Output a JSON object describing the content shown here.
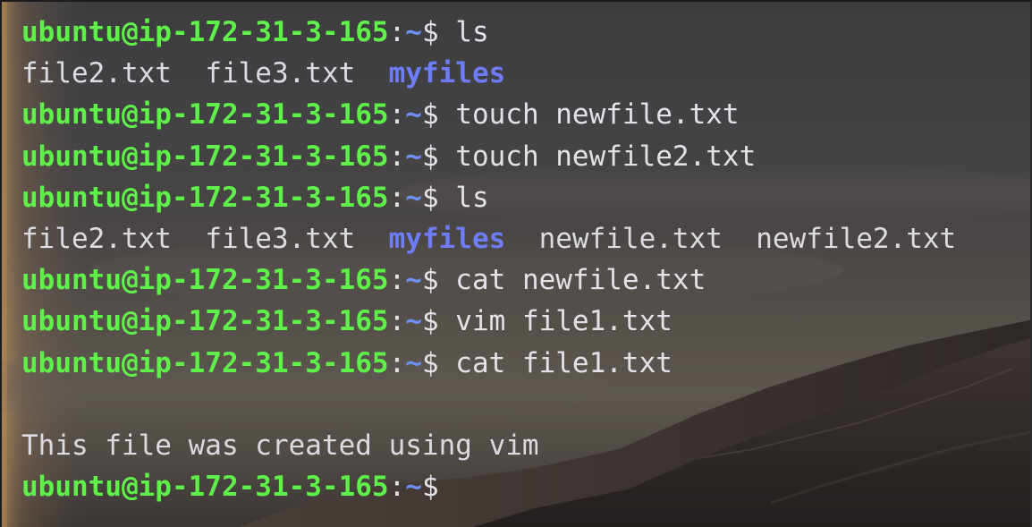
{
  "terminal": {
    "prompt": {
      "user_host": "ubuntu@ip-172-31-3-165",
      "colon": ":",
      "path": "~",
      "symbol": "$"
    },
    "lines": [
      {
        "kind": "command",
        "text": " ls"
      },
      {
        "kind": "output",
        "items": [
          {
            "text": "file2.txt",
            "type": "file"
          },
          {
            "text": "file3.txt",
            "type": "file"
          },
          {
            "text": "myfiles",
            "type": "dir"
          }
        ]
      },
      {
        "kind": "command",
        "text": " touch newfile.txt"
      },
      {
        "kind": "command",
        "text": " touch newfile2.txt"
      },
      {
        "kind": "command",
        "text": " ls"
      },
      {
        "kind": "output",
        "items": [
          {
            "text": "file2.txt",
            "type": "file"
          },
          {
            "text": "file3.txt",
            "type": "file"
          },
          {
            "text": "myfiles",
            "type": "dir"
          },
          {
            "text": "newfile.txt",
            "type": "file"
          },
          {
            "text": "newfile2.txt",
            "type": "file"
          }
        ]
      },
      {
        "kind": "command",
        "text": " cat newfile.txt"
      },
      {
        "kind": "command",
        "text": " vim file1.txt"
      },
      {
        "kind": "command",
        "text": " cat file1.txt"
      },
      {
        "kind": "blank"
      },
      {
        "kind": "text",
        "text": "This file was created using vim"
      },
      {
        "kind": "command",
        "text": ""
      }
    ]
  },
  "colors": {
    "prompt_user": "#5ff04a",
    "prompt_path": "#6f90f7",
    "directory": "#6e7cf9",
    "text": "#e3e2e6",
    "background": "#434244"
  }
}
